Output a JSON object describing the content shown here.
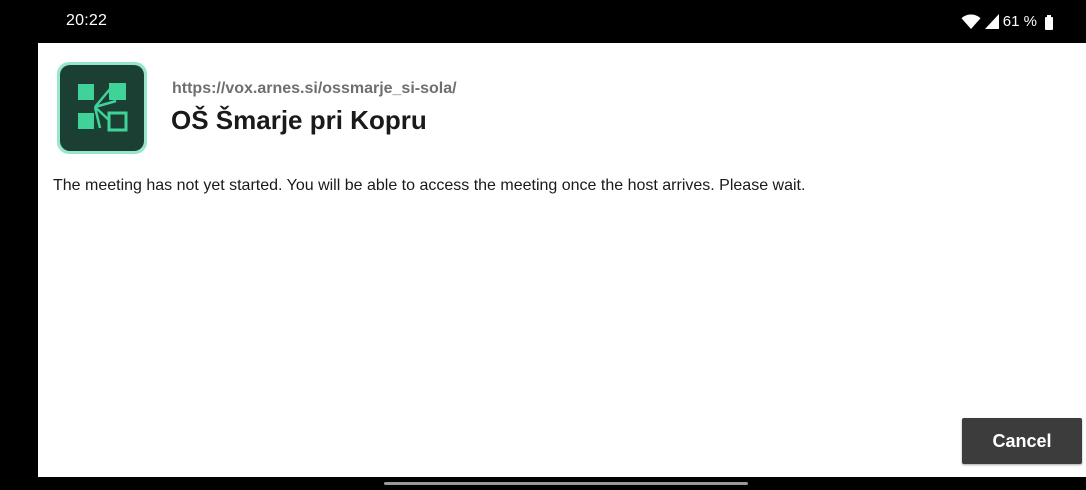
{
  "status_bar": {
    "time": "20:22",
    "battery_level": "61 %",
    "icons": [
      "wifi-icon",
      "cell-signal-icon",
      "battery-icon"
    ]
  },
  "meeting": {
    "url": "https://vox.arnes.si/ossmarje_si-sola/",
    "title": "OŠ Šmarje pri Kopru",
    "message": "The meeting has not yet started. You will be able to access the meeting once the host arrives. Please wait."
  },
  "actions": {
    "cancel_label": "Cancel"
  },
  "colors": {
    "app_icon_background": "#1c3f34",
    "app_icon_accent": "#3fd39a",
    "button_background": "#3c3c3c"
  }
}
